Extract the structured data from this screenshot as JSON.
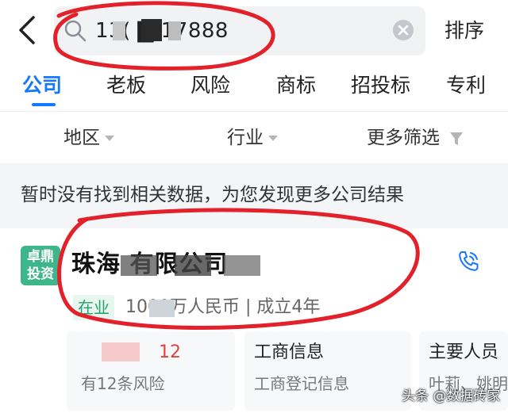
{
  "search": {
    "query": "13( ▇ 17888"
  },
  "header": {
    "sort_label": "排序"
  },
  "tabs": [
    {
      "label": "公司",
      "active": true
    },
    {
      "label": "老板"
    },
    {
      "label": "风险"
    },
    {
      "label": "商标"
    },
    {
      "label": "招投标"
    },
    {
      "label": "专利"
    }
  ],
  "filters": {
    "region": "地区",
    "industry": "行业",
    "more": "更多筛选"
  },
  "notice": "暂时没有找到相关数据，为您发现更多公司结果",
  "company": {
    "logo_line1": "卓鼎",
    "logo_line2": "投资",
    "name": "珠海                       有限公司",
    "status": "在业",
    "info": "                  1000万人民币  |  成立4年",
    "cards": {
      "risk_count": "12",
      "risk_sub": "有12条风险",
      "biz_title": "工商信息",
      "biz_sub": "工商登记信息",
      "people_title": "主要人员",
      "people_sub": "叶莉、姚明"
    }
  },
  "watermark": "头条 @数据砖家",
  "colors": {
    "accent": "#1677ff",
    "status_green": "#23a36b",
    "logo_green": "#3fb58b",
    "risk_red": "#e0433b",
    "annotation_red": "#e3212b"
  }
}
